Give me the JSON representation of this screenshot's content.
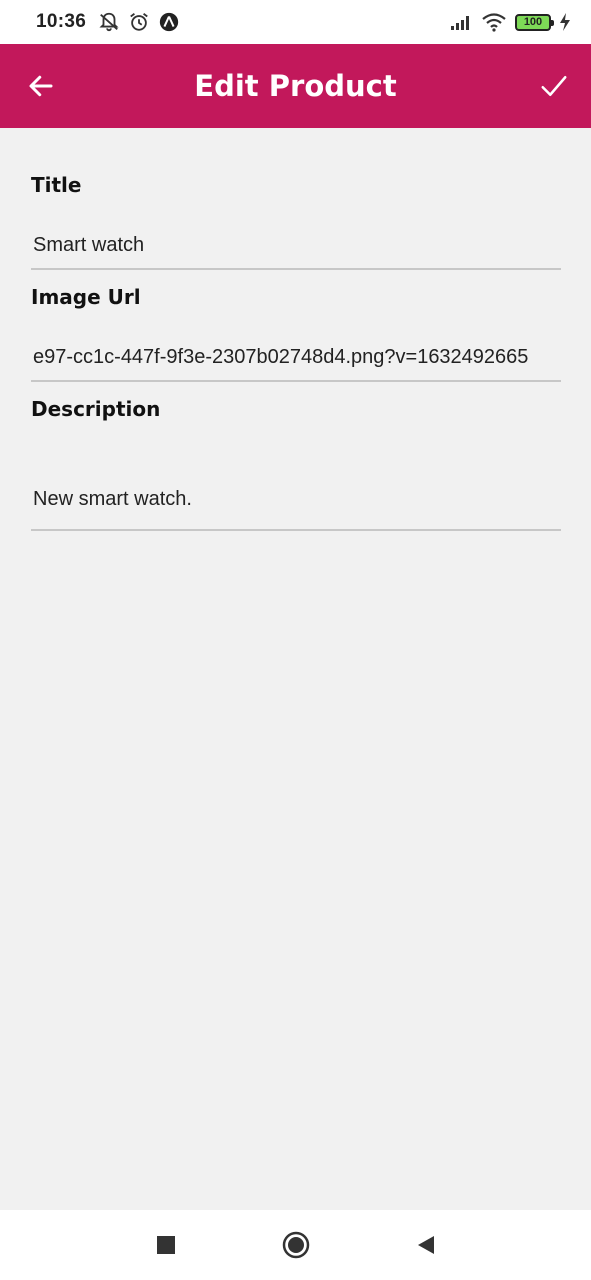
{
  "status_bar": {
    "time": "10:36",
    "battery": "100",
    "icons": [
      "notifications-off-icon",
      "alarm-icon",
      "app-notification-icon",
      "signal-icon",
      "wifi-icon",
      "battery-icon",
      "charging-icon"
    ]
  },
  "app_bar": {
    "title": "Edit Product",
    "back_icon": "arrow-left-icon",
    "save_icon": "check-icon",
    "color": "#c2185b"
  },
  "form": {
    "title": {
      "label": "Title",
      "value": "Smart watch"
    },
    "image_url": {
      "label": "Image Url",
      "value": "e97-cc1c-447f-9f3e-2307b02748d4.png?v=1632492665"
    },
    "description": {
      "label": "Description",
      "value": "New smart watch."
    }
  },
  "nav_bar": {
    "icons": [
      "recents-square-icon",
      "home-circle-icon",
      "back-triangle-icon"
    ]
  }
}
